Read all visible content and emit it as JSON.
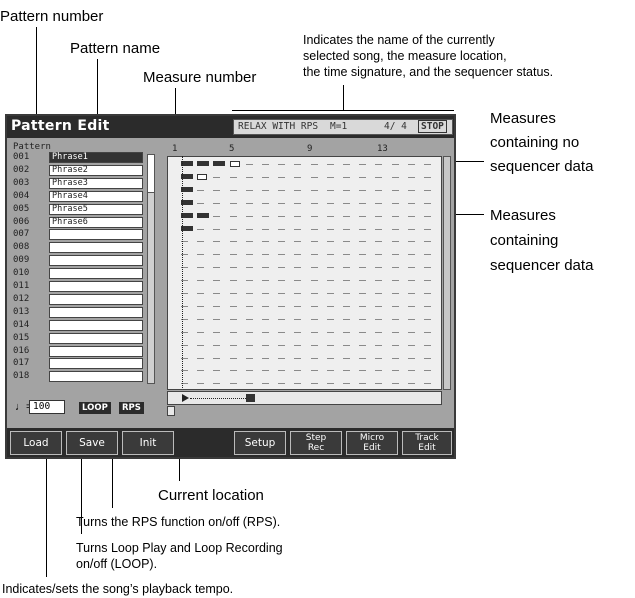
{
  "callouts": {
    "pattern_number": "Pattern number",
    "pattern_name": "Pattern name",
    "measure_number": "Measure number",
    "indicates_1": "Indicates the name of the currently",
    "indicates_2": "selected song, the measure location,",
    "indicates_3": "the time signature, and the sequencer status.",
    "no_data_1": "Measures",
    "no_data_2": "containing no",
    "no_data_3": "sequencer data",
    "data_1": "Measures",
    "data_2": "containing",
    "data_3": "sequencer data",
    "current_location": "Current location",
    "rps": "Turns the RPS function on/off (RPS).",
    "loop_1": "Turns Loop Play and Loop Recording",
    "loop_2": "on/off (LOOP).",
    "tempo": "Indicates/sets the song’s playback tempo."
  },
  "screen": {
    "title": "Pattern Edit",
    "status": {
      "song": "RELAX WITH RPS",
      "measure": "M=1",
      "time_sig": "4/ 4",
      "seq_status": "STOP"
    },
    "list_header": "Pattern",
    "patterns": [
      {
        "num": "001",
        "name": "Phrase1"
      },
      {
        "num": "002",
        "name": "Phrase2"
      },
      {
        "num": "003",
        "name": "Phrase3"
      },
      {
        "num": "004",
        "name": "Phrase4"
      },
      {
        "num": "005",
        "name": "Phrase5"
      },
      {
        "num": "006",
        "name": "Phrase6"
      },
      {
        "num": "007",
        "name": ""
      },
      {
        "num": "008",
        "name": ""
      },
      {
        "num": "009",
        "name": ""
      },
      {
        "num": "010",
        "name": ""
      },
      {
        "num": "011",
        "name": ""
      },
      {
        "num": "012",
        "name": ""
      },
      {
        "num": "013",
        "name": ""
      },
      {
        "num": "014",
        "name": ""
      },
      {
        "num": "015",
        "name": ""
      },
      {
        "num": "016",
        "name": ""
      },
      {
        "num": "017",
        "name": ""
      },
      {
        "num": "018",
        "name": ""
      }
    ],
    "measure_labels": [
      "1",
      "5",
      "9",
      "13"
    ],
    "tempo_symbol": "♩=",
    "tempo": "100",
    "loop_label": "LOOP",
    "rps_label": "RPS",
    "buttons": [
      "Load",
      "Save",
      "Init",
      "Setup",
      "Step\nRec",
      "Micro\nEdit",
      "Track\nEdit"
    ]
  }
}
